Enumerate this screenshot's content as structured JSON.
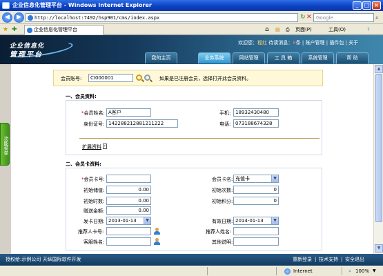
{
  "window": {
    "title": "企业信息化管理平台 - Windows Internet Explorer"
  },
  "browser": {
    "url": "http://localhost:7492/hsp901/cms/index.aspx",
    "search_placeholder": "Google",
    "tab_title": "企业信息化管理平台",
    "toolbar": {
      "page": "页面(P)",
      "tools": "工具(O)"
    }
  },
  "header": {
    "logo_line1": "企业信息化",
    "logo_line2": "管理平台",
    "welcome_prefix": "欢迎您：",
    "user": "程红",
    "pending_label": "待读消息：",
    "pending_count": "8",
    "pending_unit": "条",
    "links": [
      "账户管理",
      "插件包",
      "关于"
    ],
    "nav_tabs": [
      {
        "label": "我的主页",
        "active": false
      },
      {
        "label": "业务系统",
        "active": true
      },
      {
        "label": "网站管理",
        "active": false
      },
      {
        "label": "工 具 箱",
        "active": false
      },
      {
        "label": "系统管理",
        "active": false
      },
      {
        "label": "帮  助",
        "active": false
      }
    ]
  },
  "side": {
    "handle_label": "功能菜单"
  },
  "account": {
    "label": "会员账号:",
    "value": "CI000001",
    "hint": "如果是已注册会员，选择打开此会员资料。"
  },
  "member_section": {
    "title": "一、会员资料:",
    "name_label": "会员姓名:",
    "name_value": "A客户",
    "phone_label": "手机:",
    "phone_value": "18932430480",
    "id_label": "身份证号:",
    "id_value": "142288212881211222",
    "tel_label": "电话:",
    "tel_value": "073188674328",
    "expand_label": "扩展资料"
  },
  "card_section": {
    "title": "二、会员卡资料:",
    "card_no_label": "会员卡号:",
    "card_no_value": "",
    "card_name_label": "会员卡名:",
    "card_name_value": "充值卡",
    "init_balance_label": "初始储值:",
    "init_balance_value": "0.00",
    "init_times_label": "初始次数:",
    "init_times_value": "0",
    "init_hours_label": "初始时数:",
    "init_hours_value": "0.00",
    "init_points_label": "初始积分:",
    "init_points_value": "0",
    "gift_amount_label": "赠送金额:",
    "gift_amount_value": "0.00",
    "issue_date_label": "发卡日期:",
    "issue_date_value": "2013-01-13",
    "valid_date_label": "有效日期:",
    "valid_date_value": "2014-01-13",
    "referrer_card_label": "推荐人卡号:",
    "referrer_name_label": "推荐人姓名:",
    "service_label": "客服姓名:",
    "other_label": "其他说明:"
  },
  "footer": {
    "left": "授权给:示例公司  天纵国际软件开发",
    "links": [
      "重新登录",
      "技术支持",
      "安全退出"
    ]
  },
  "status": {
    "zone": "Internet",
    "zoom": "100%"
  }
}
